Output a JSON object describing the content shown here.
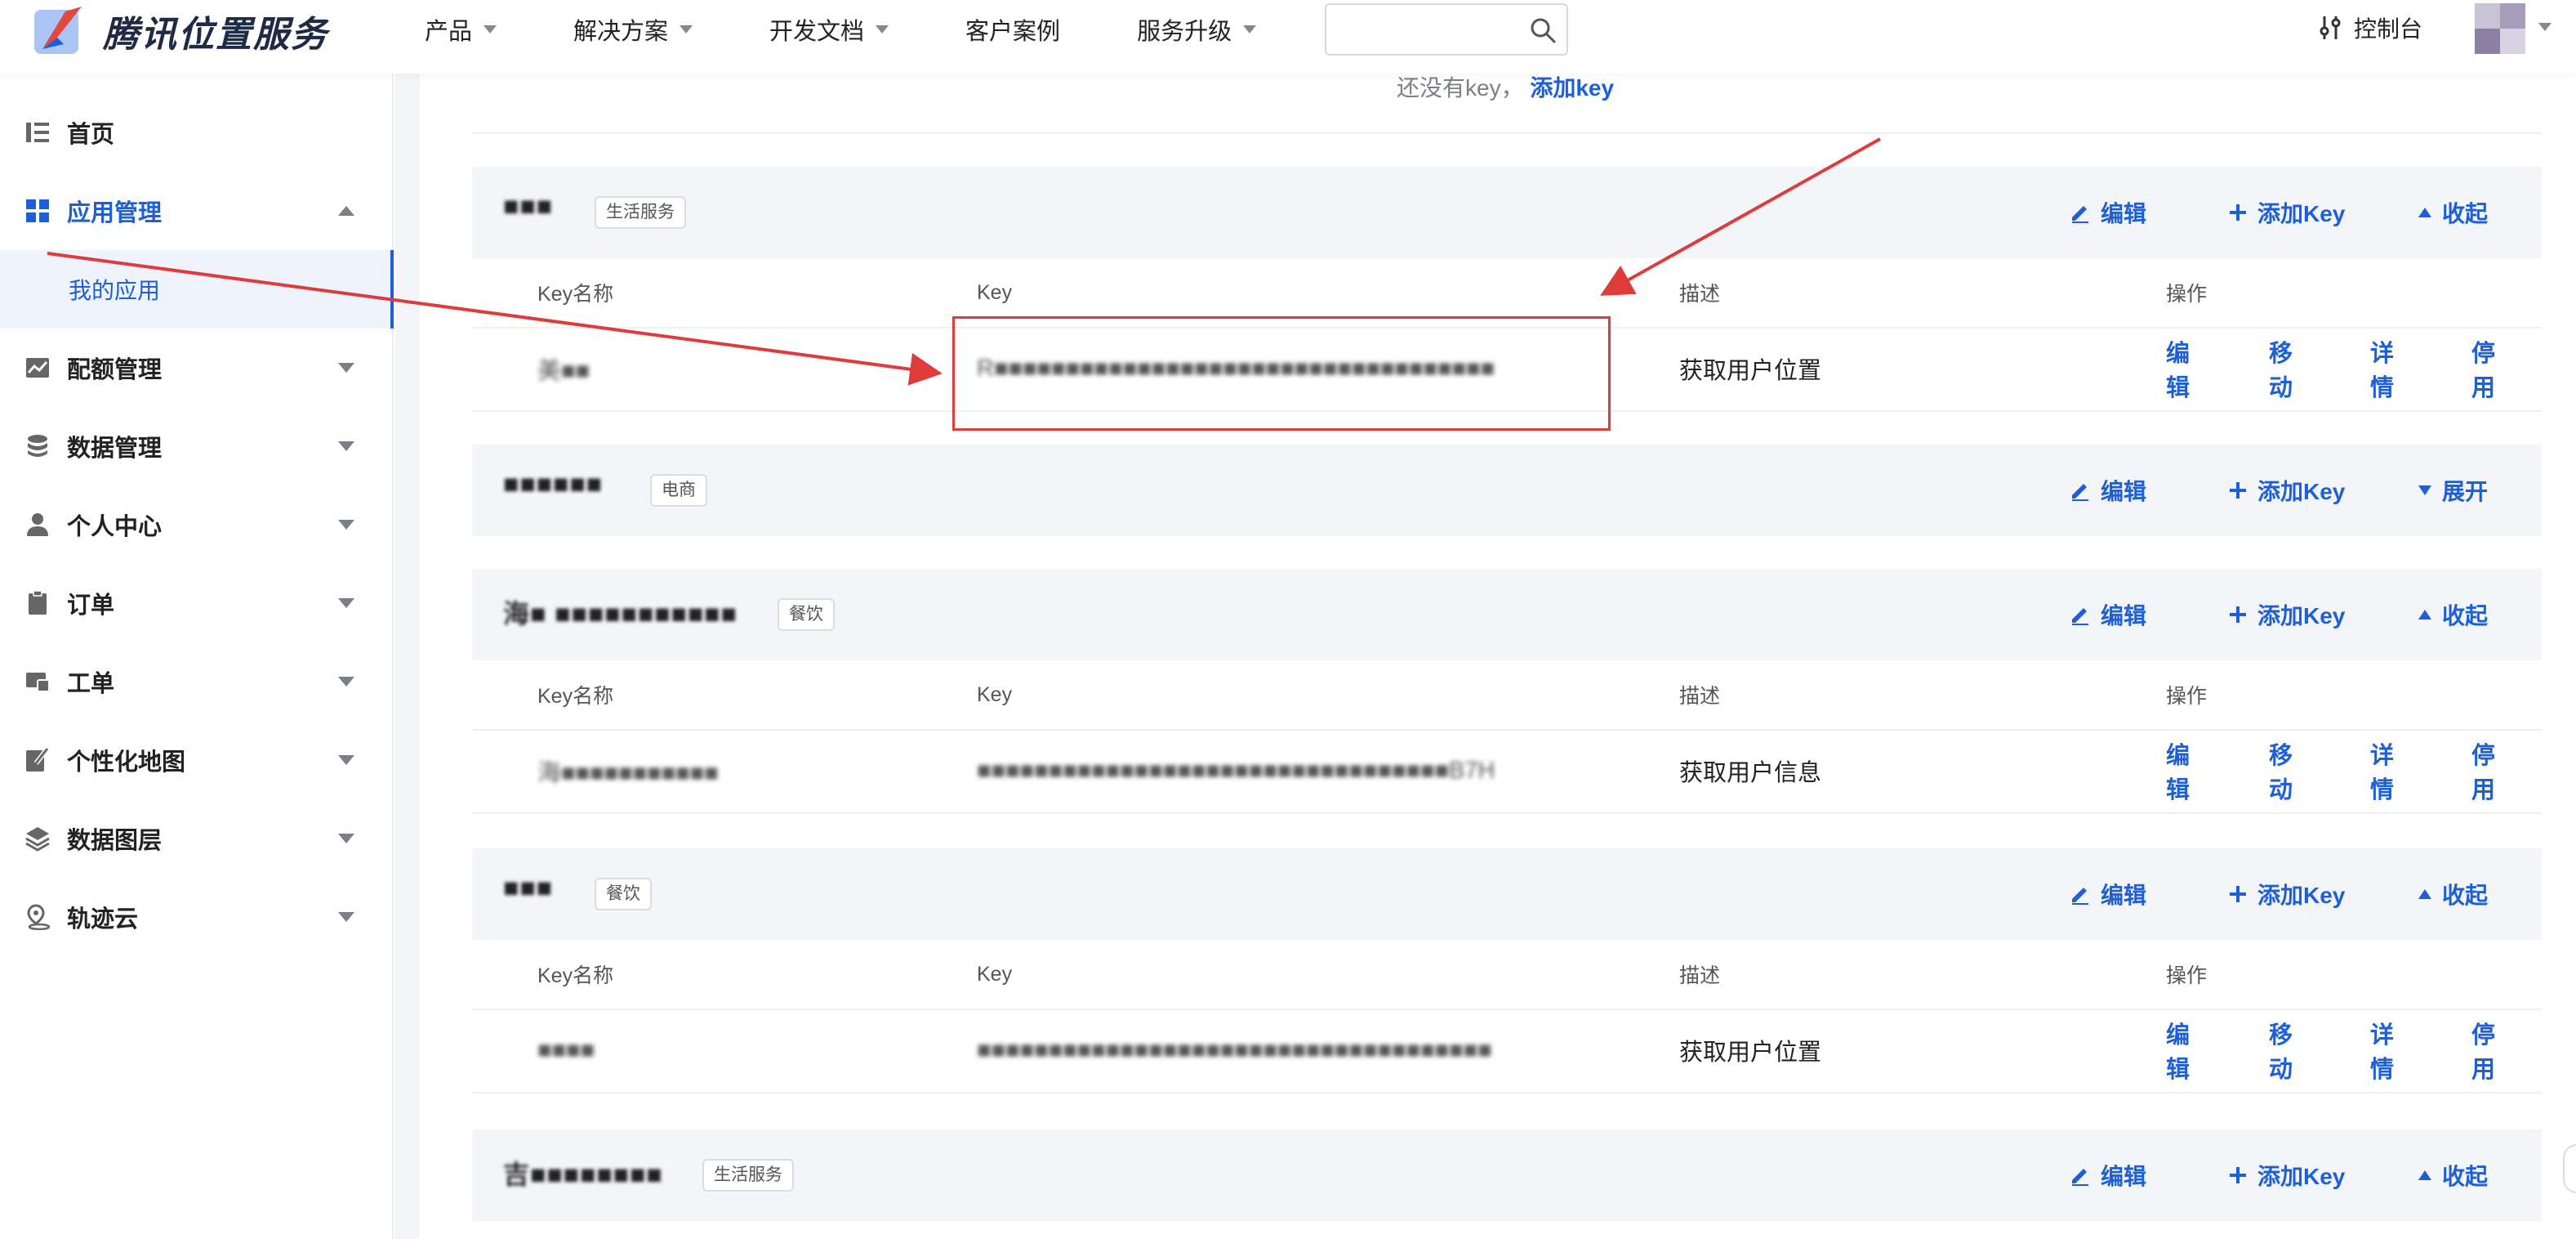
{
  "brand": {
    "name": "腾讯位置服务"
  },
  "nav": {
    "items": [
      "产品",
      "解决方案",
      "开发文档",
      "客户案例",
      "服务升级"
    ],
    "console": "控制台",
    "search_placeholder": ""
  },
  "sidebar": {
    "items": [
      {
        "label": "首页"
      },
      {
        "label": "应用管理"
      },
      {
        "label": "配额管理"
      },
      {
        "label": "数据管理"
      },
      {
        "label": "个人中心"
      },
      {
        "label": "订单"
      },
      {
        "label": "工单"
      },
      {
        "label": "个性化地图"
      },
      {
        "label": "数据图层"
      },
      {
        "label": "轨迹云"
      }
    ],
    "sub_item": "我的应用"
  },
  "main": {
    "empty_hint": "还没有key，",
    "add_key_link": "添加key",
    "columns": {
      "name": "Key名称",
      "key": "Key",
      "desc": "描述",
      "ops": "操作"
    },
    "actions": {
      "edit": "编辑",
      "add_key": "添加Key",
      "collapse": "收起",
      "expand": "展开"
    },
    "row_ops": {
      "edit": "编辑",
      "move": "移动",
      "detail": "详情",
      "disable": "停用"
    },
    "apps": [
      {
        "name": "■■■",
        "tag": "生活服务",
        "expanded": true,
        "row": {
          "name": "美■■",
          "key": "R■■■■■■■■■■■■■■■■■■■■■■■■■■■■■■■■■■■",
          "desc": "获取用户位置"
        }
      },
      {
        "name": "■■■■■■",
        "tag": "电商",
        "expanded": false
      },
      {
        "name": "海■ ■■■■■■■■■■■",
        "tag": "餐饮",
        "expanded": true,
        "row": {
          "name": "海■■■■■■■■■■■",
          "key": "■■■■■■■■■■■■■■■■■■■■■■■■■■■■■■■■■B7H",
          "desc": "获取用户信息"
        }
      },
      {
        "name": "■■■",
        "tag": "餐饮",
        "expanded": true,
        "row": {
          "name": "■■■■",
          "key": "■■■■■■■■■■■■■■■■■■■■■■■■■■■■■■■■■■■■",
          "desc": "获取用户位置"
        }
      },
      {
        "name": "吉■■■■■■■■",
        "tag": "生活服务",
        "expanded": true
      }
    ]
  },
  "colors": {
    "accent": "#1d5fd8",
    "annotation": "#e03b3b",
    "panel": "#f3f5f9"
  }
}
